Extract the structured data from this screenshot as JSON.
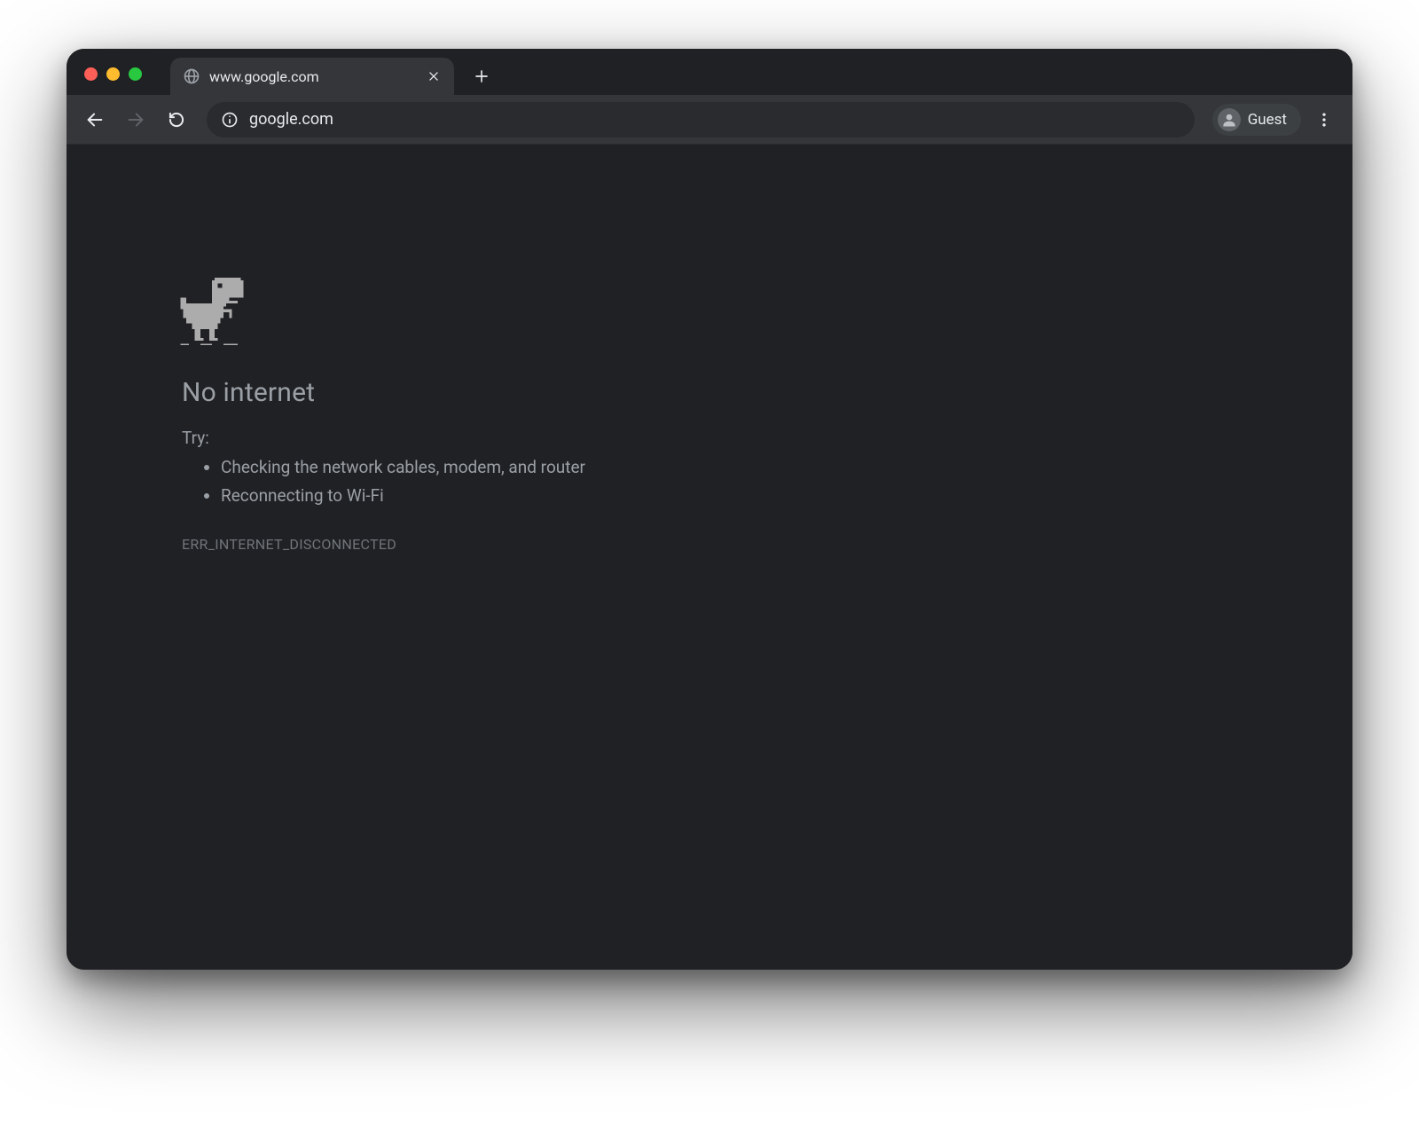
{
  "tab": {
    "title": "www.google.com"
  },
  "toolbar": {
    "url": "google.com",
    "profile_label": "Guest"
  },
  "error": {
    "heading": "No internet",
    "try_label": "Try:",
    "suggestions": [
      "Checking the network cables, modem, and router",
      "Reconnecting to Wi-Fi"
    ],
    "code": "ERR_INTERNET_DISCONNECTED"
  }
}
